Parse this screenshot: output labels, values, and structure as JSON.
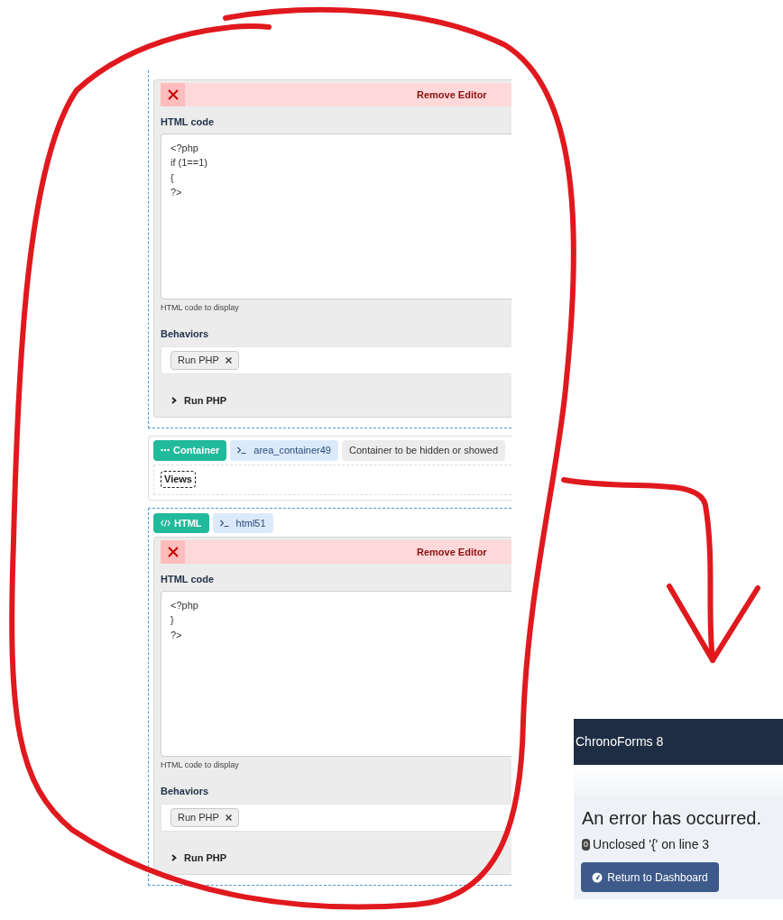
{
  "form_editor": {
    "sections": [
      {
        "kind": "editor",
        "remove_label": "Remove Editor",
        "field_label": "HTML code",
        "code": "<?php\nif (1==1)\n{\n?>",
        "help": "HTML code to display",
        "behaviors_label": "Behaviors",
        "behaviors": [
          "Run PHP"
        ],
        "accordion": {
          "label": "Run PHP",
          "expanded": false
        }
      },
      {
        "kind": "container",
        "badges": [
          {
            "kind": "type",
            "label": "Container"
          },
          {
            "kind": "name",
            "label": "area_container49"
          },
          {
            "kind": "note",
            "label": "Container to be hidden or showed"
          }
        ],
        "view_label": "Views"
      },
      {
        "kind": "editor",
        "badges": [
          {
            "kind": "type",
            "label": "HTML"
          },
          {
            "kind": "name",
            "label": "html51"
          }
        ],
        "remove_label": "Remove Editor",
        "field_label": "HTML code",
        "code": "<?php\n}\n?>",
        "help": "HTML code to display",
        "behaviors_label": "Behaviors",
        "behaviors": [
          "Run PHP"
        ],
        "accordion": {
          "label": "Run PHP",
          "expanded": false
        }
      }
    ]
  },
  "error_page": {
    "app_title": "ChronoForms 8",
    "heading": "An error has occurred.",
    "error_code": "0",
    "message": "Unclosed '{' on line 3",
    "button": "Return to Dashboard"
  }
}
